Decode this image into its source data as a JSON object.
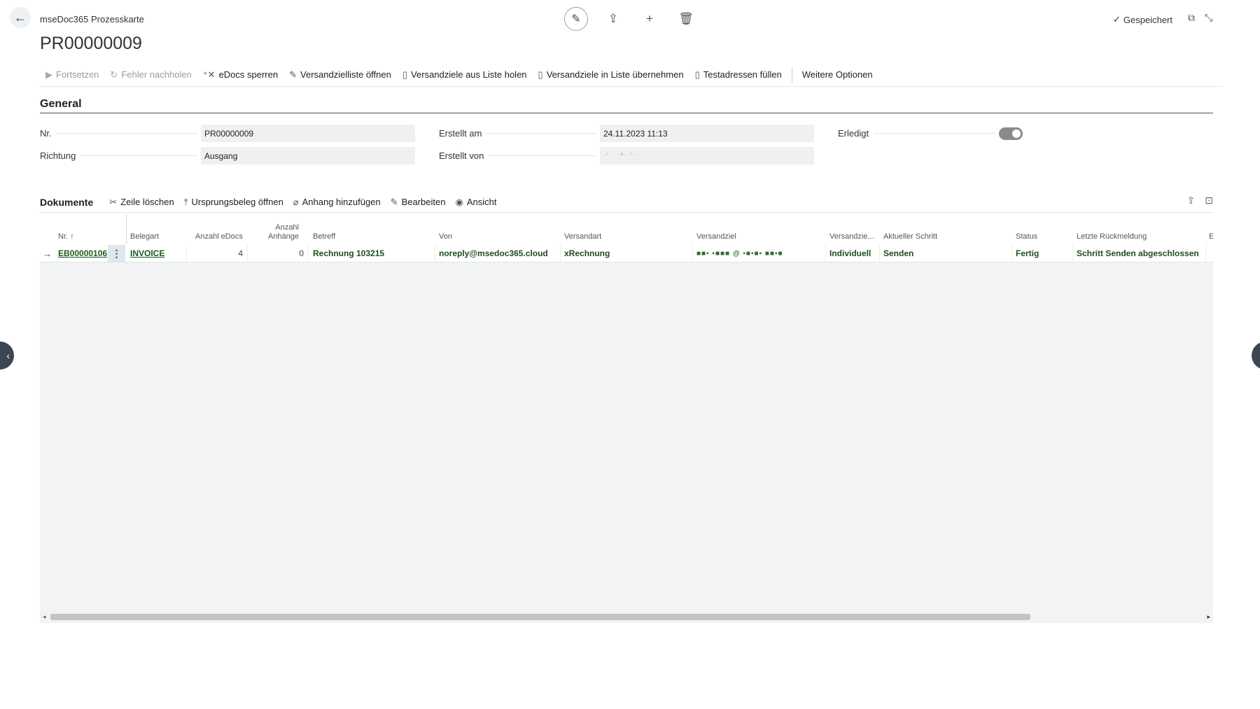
{
  "header": {
    "caption": "mseDoc365 Prozesskarte",
    "title": "PR00000009",
    "saved_label": "Gespeichert"
  },
  "actions": [
    {
      "label": "Fortsetzen",
      "icon": "play-icon",
      "disabled": true
    },
    {
      "label": "Fehler nachholen",
      "icon": "refresh-icon",
      "disabled": true
    },
    {
      "label": "eDocs sperren",
      "icon": "lock-icon",
      "disabled": false
    },
    {
      "label": "Versandzielliste öffnen",
      "icon": "list-edit-icon",
      "disabled": false
    },
    {
      "label": "Versandziele aus Liste holen",
      "icon": "document-icon",
      "disabled": false
    },
    {
      "label": "Versandziele in Liste übernehmen",
      "icon": "document-icon",
      "disabled": false
    },
    {
      "label": "Testadressen füllen",
      "icon": "document-icon",
      "disabled": false
    },
    {
      "label": "Weitere Optionen",
      "icon": "",
      "disabled": false
    }
  ],
  "general": {
    "title": "General",
    "nr_label": "Nr.",
    "nr_value": "PR00000009",
    "richtung_label": "Richtung",
    "richtung_value": "Ausgang",
    "erstellt_am_label": "Erstellt am",
    "erstellt_am_value": "24.11.2023 11:13",
    "erstellt_von_label": "Erstellt von",
    "erstellt_von_value": "ᐧᐟ ᐧ ᐧᐞᐧ ᐟᐧ ᐧ",
    "erledigt_label": "Erledigt",
    "erledigt_value": true
  },
  "documents": {
    "title": "Dokumente",
    "actions": [
      {
        "label": "Zeile löschen",
        "icon": "delete-rows-icon"
      },
      {
        "label": "Ursprungsbeleg öffnen",
        "icon": "upload-icon"
      },
      {
        "label": "Anhang hinzufügen",
        "icon": "paperclip-icon"
      },
      {
        "label": "Bearbeiten",
        "icon": "pencil-icon"
      },
      {
        "label": "Ansicht",
        "icon": "eye-icon"
      }
    ],
    "columns": {
      "nr": "Nr. ↑",
      "belegart": "Belegart",
      "anzahl_edocs": "Anzahl eDocs",
      "anzahl_anhaenge_1": "Anzahl",
      "anzahl_anhaenge_2": "Anhänge",
      "betreff": "Betreff",
      "von": "Von",
      "versandart": "Versandart",
      "versandziel": "Versandziel",
      "versandziel_typ": "Versandzie...",
      "aktueller_schritt": "Aktueller Schritt",
      "status": "Status",
      "letzte_rueckmeldung": "Letzte Rückmeldung",
      "extra": "E"
    },
    "rows": [
      {
        "nr": "EB00000106",
        "belegart": "INVOICE",
        "anzahl_edocs": "4",
        "anzahl_anhaenge": "0",
        "betreff": "Rechnung 103215",
        "von": "noreply@msedoc365.cloud",
        "versandart": "xRechnung",
        "versandziel": "■■▪ ▪■■■ @ ▪■▪■▪ ■■▪■",
        "versandziel_typ": "Individuell",
        "aktueller_schritt": "Senden",
        "status": "Fertig",
        "letzte_rueckmeldung": "Schritt Senden abgeschlossen"
      }
    ]
  }
}
